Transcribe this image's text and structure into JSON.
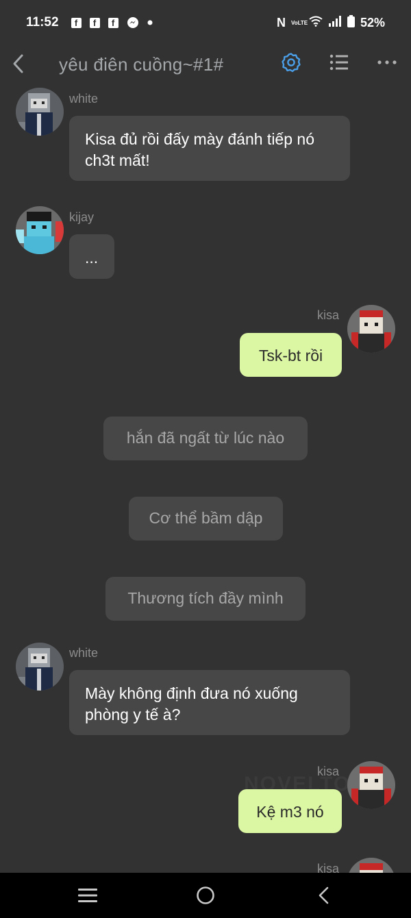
{
  "status_bar": {
    "time": "11:52",
    "notification_icons": [
      "facebook-icon",
      "facebook-icon",
      "facebook-icon",
      "messenger-icon",
      "dot-icon"
    ],
    "battery": "52%",
    "network": "VoLTE"
  },
  "header": {
    "title": "yêu điên cuồng~#1#",
    "accent_color": "#4a9fe8"
  },
  "messages": [
    {
      "side": "left",
      "sender": "white",
      "text": "Kisa đủ rồi đấy mày đánh tiếp nó ch3t mất!"
    },
    {
      "side": "left",
      "sender": "kijay",
      "text": "..."
    },
    {
      "side": "right",
      "sender": "kisa",
      "text": "Tsk-bt rồi"
    },
    {
      "side": "center",
      "text": "hắn đã ngất từ lúc nào"
    },
    {
      "side": "center",
      "text": "Cơ thể bầm dập"
    },
    {
      "side": "center",
      "text": "Thương tích đầy mình"
    },
    {
      "side": "left",
      "sender": "white",
      "text": "Mày không định đưa nó xuống phòng y tế à?"
    },
    {
      "side": "right",
      "sender": "kisa",
      "text": "Kệ m3 nó"
    },
    {
      "side": "right",
      "sender": "kisa",
      "text": ""
    }
  ],
  "watermark": "NOVELTOON",
  "colors": {
    "background": "#323232",
    "bubble_left": "#474747",
    "bubble_right": "#dcf7a3",
    "name_text": "#8c8c8c"
  }
}
